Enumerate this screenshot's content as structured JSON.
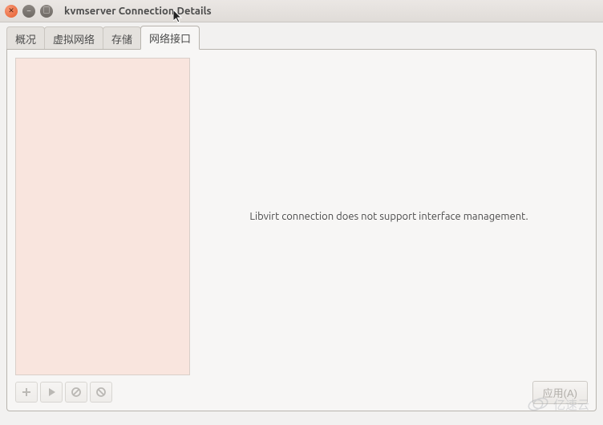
{
  "window": {
    "title": "kvmserver Connection Details"
  },
  "tabs": {
    "overview": "概况",
    "virtual_networks": "虚拟网络",
    "storage": "存储",
    "network_interfaces": "网络接口"
  },
  "active_tab": "network_interfaces",
  "content": {
    "message": "Libvirt connection does not support interface management."
  },
  "toolbar": {
    "add_tooltip": "Add",
    "start_tooltip": "Start",
    "stop_tooltip": "Stop",
    "delete_tooltip": "Delete"
  },
  "buttons": {
    "apply": "应用(A)"
  },
  "watermark": {
    "text": "亿速云"
  }
}
